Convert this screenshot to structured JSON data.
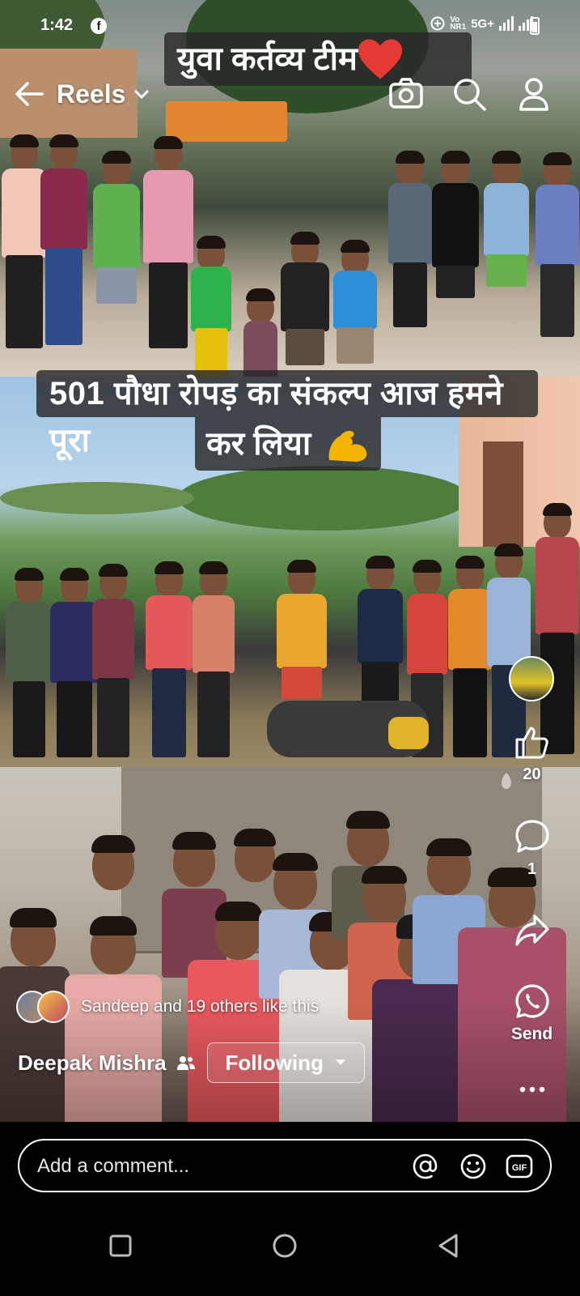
{
  "status_bar": {
    "time": "1:42",
    "network": "5G+"
  },
  "top_bar": {
    "title": "Reels"
  },
  "captions": {
    "top": "युवा कर्तव्य टीम",
    "middle_line1": "501 पौधा रोपड़ का संकल्प  आज हमने पूरा",
    "middle_line2": "कर लिया"
  },
  "actions": {
    "like_count": "20",
    "comment_count": "1",
    "send_label": "Send"
  },
  "post": {
    "likes_text": "Sandeep and 19 others like this",
    "author": "Deepak Mishra",
    "follow_label": "Following"
  },
  "comment": {
    "placeholder": "Add a comment..."
  },
  "colors": {
    "accent_heart": "#e53935",
    "flex_emoji": "#f5b400",
    "overlay_banner": "#282828"
  }
}
